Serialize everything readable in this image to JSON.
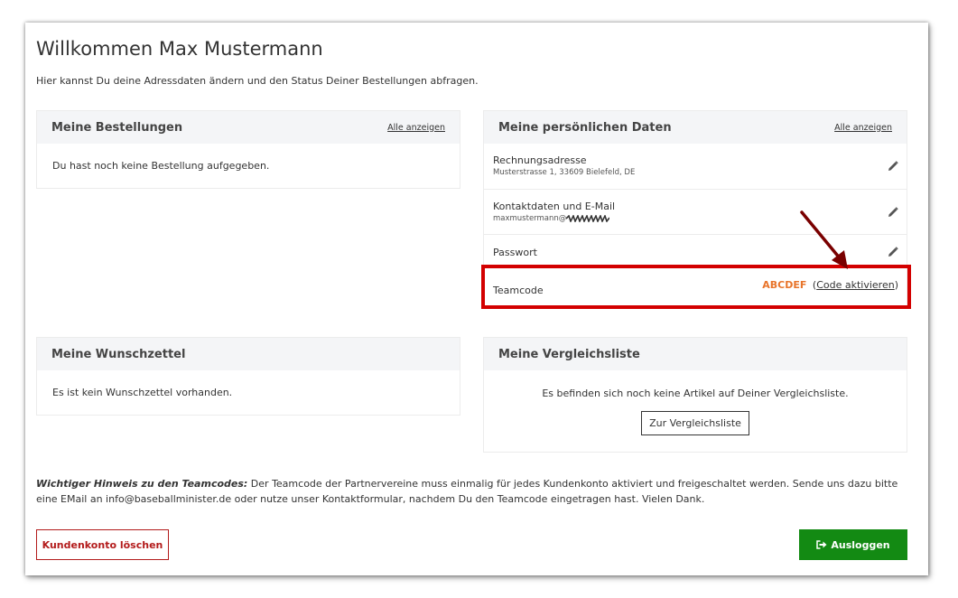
{
  "page": {
    "title": "Willkommen Max Mustermann",
    "intro": "Hier kannst Du deine Adressdaten ändern und den Status Deiner Bestellungen abfragen."
  },
  "orders": {
    "title": "Meine Bestellungen",
    "link": "Alle anzeigen",
    "empty_text": "Du hast noch keine Bestellung aufgegeben."
  },
  "personal": {
    "title": "Meine persönlichen Daten",
    "link": "Alle anzeigen",
    "rows": [
      {
        "label": "Rechnungsadresse",
        "value": "Musterstrasse 1, 33609 Bielefeld, DE",
        "edit_icon": "pencil-icon"
      },
      {
        "label": "Kontaktdaten und E-Mail",
        "value": "maxmustermann@",
        "edit_icon": "pencil-icon"
      },
      {
        "label": "Passwort",
        "edit_icon": "pencil-icon"
      }
    ],
    "teamcode": {
      "label": "Teamcode",
      "code": "ABCDEF",
      "open_paren": "(",
      "activate_link": "Code aktivieren",
      "close_paren": ")"
    }
  },
  "wishlist": {
    "title": "Meine Wunschzettel",
    "empty_text": "Es ist kein Wunschzettel vorhanden."
  },
  "compare": {
    "title": "Meine Vergleichsliste",
    "empty_text": "Es befinden sich noch keine Artikel auf Deiner Vergleichsliste.",
    "button": "Zur Vergleichsliste"
  },
  "notice": {
    "label": "Wichtiger Hinweis zu den Teamcodes:",
    "text": " Der Teamcode der Partnervereine muss einmalig für jedes Kundenkonto aktiviert und freigeschaltet werden. Sende uns dazu bitte eine EMail an info@baseballminister.de oder nutze unser Kontaktformular, nachdem Du den Teamcode eingetragen hast. Vielen Dank."
  },
  "actions": {
    "delete": "Kundenkonto löschen",
    "logout": "Ausloggen",
    "logout_icon": "sign-out-icon"
  },
  "colors": {
    "highlight_border": "#d30000",
    "arrow": "#7a0000",
    "code": "#e8742a",
    "logout_bg": "#138a13",
    "delete": "#b31b1b"
  }
}
